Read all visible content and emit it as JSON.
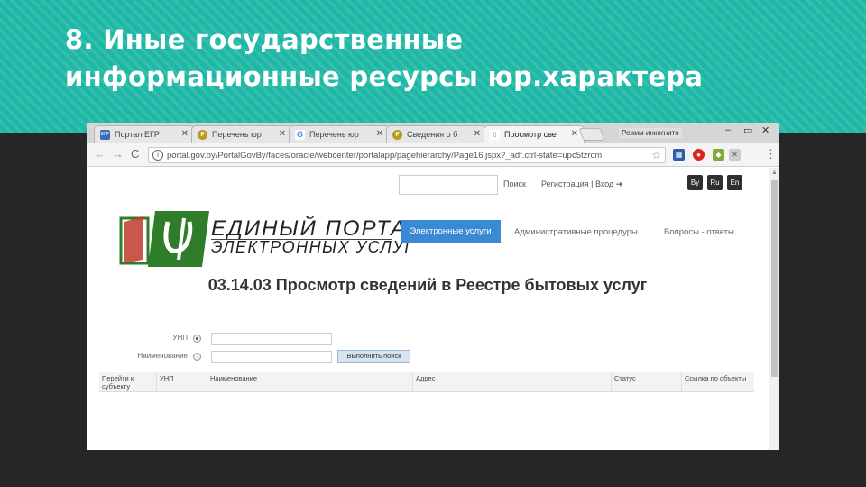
{
  "slide": {
    "title_line1": "8. Иные государственные",
    "title_line2": "информационные ресурсы юр.характера"
  },
  "browser": {
    "tabs": [
      {
        "label": "Портал ЕГР",
        "favicon": "ЕГР",
        "favicon_color": "#3a6fb0"
      },
      {
        "label": "Перечень юр",
        "favicon": "₽",
        "favicon_color": "#b89a1c"
      },
      {
        "label": "Перечень юр",
        "favicon": "G",
        "favicon_color": "#4a8af4"
      },
      {
        "label": "Сведения о б",
        "favicon": "₽",
        "favicon_color": "#b89a1c"
      },
      {
        "label": "Просмотр све",
        "favicon": "▯",
        "favicon_color": "#888888"
      }
    ],
    "tab_close": "✕",
    "user_badge": "Режим инкогнито",
    "url": "portal.gov.by/PortalGovBy/faces/oracle/webcenter/portalapp/pagehierarchy/Page16.jspx?_adf.ctrl-state=upc5tzrcm"
  },
  "site": {
    "search_label": "Поиск",
    "auth_label": "Регистрация | Вход",
    "languages": [
      "By",
      "Ru",
      "En"
    ],
    "logo_line1": "ЕДИНЫЙ ПОРТАЛ",
    "logo_line2": "ЭЛЕКТРОННЫХ УСЛУГ",
    "nav": [
      "Электронные услуги",
      "Административные процедуры",
      "Вопросы - ответы"
    ]
  },
  "main": {
    "heading": "03.14.03 Просмотр сведений в Реестре бытовых услуг",
    "form": {
      "unp_label": "УНП",
      "name_label": "Наименование",
      "search_button": "Выполнить поиск"
    },
    "table_columns": [
      "Перейти к субъекту",
      "УНП",
      "Наименование",
      "Адрес",
      "Статус",
      "Ссылка по объекты"
    ]
  },
  "colors": {
    "accent": "#1fb8a6",
    "nav_primary": "#3a8ad3",
    "logo_green": "#2f7d2a",
    "logo_red": "#c0392b"
  }
}
